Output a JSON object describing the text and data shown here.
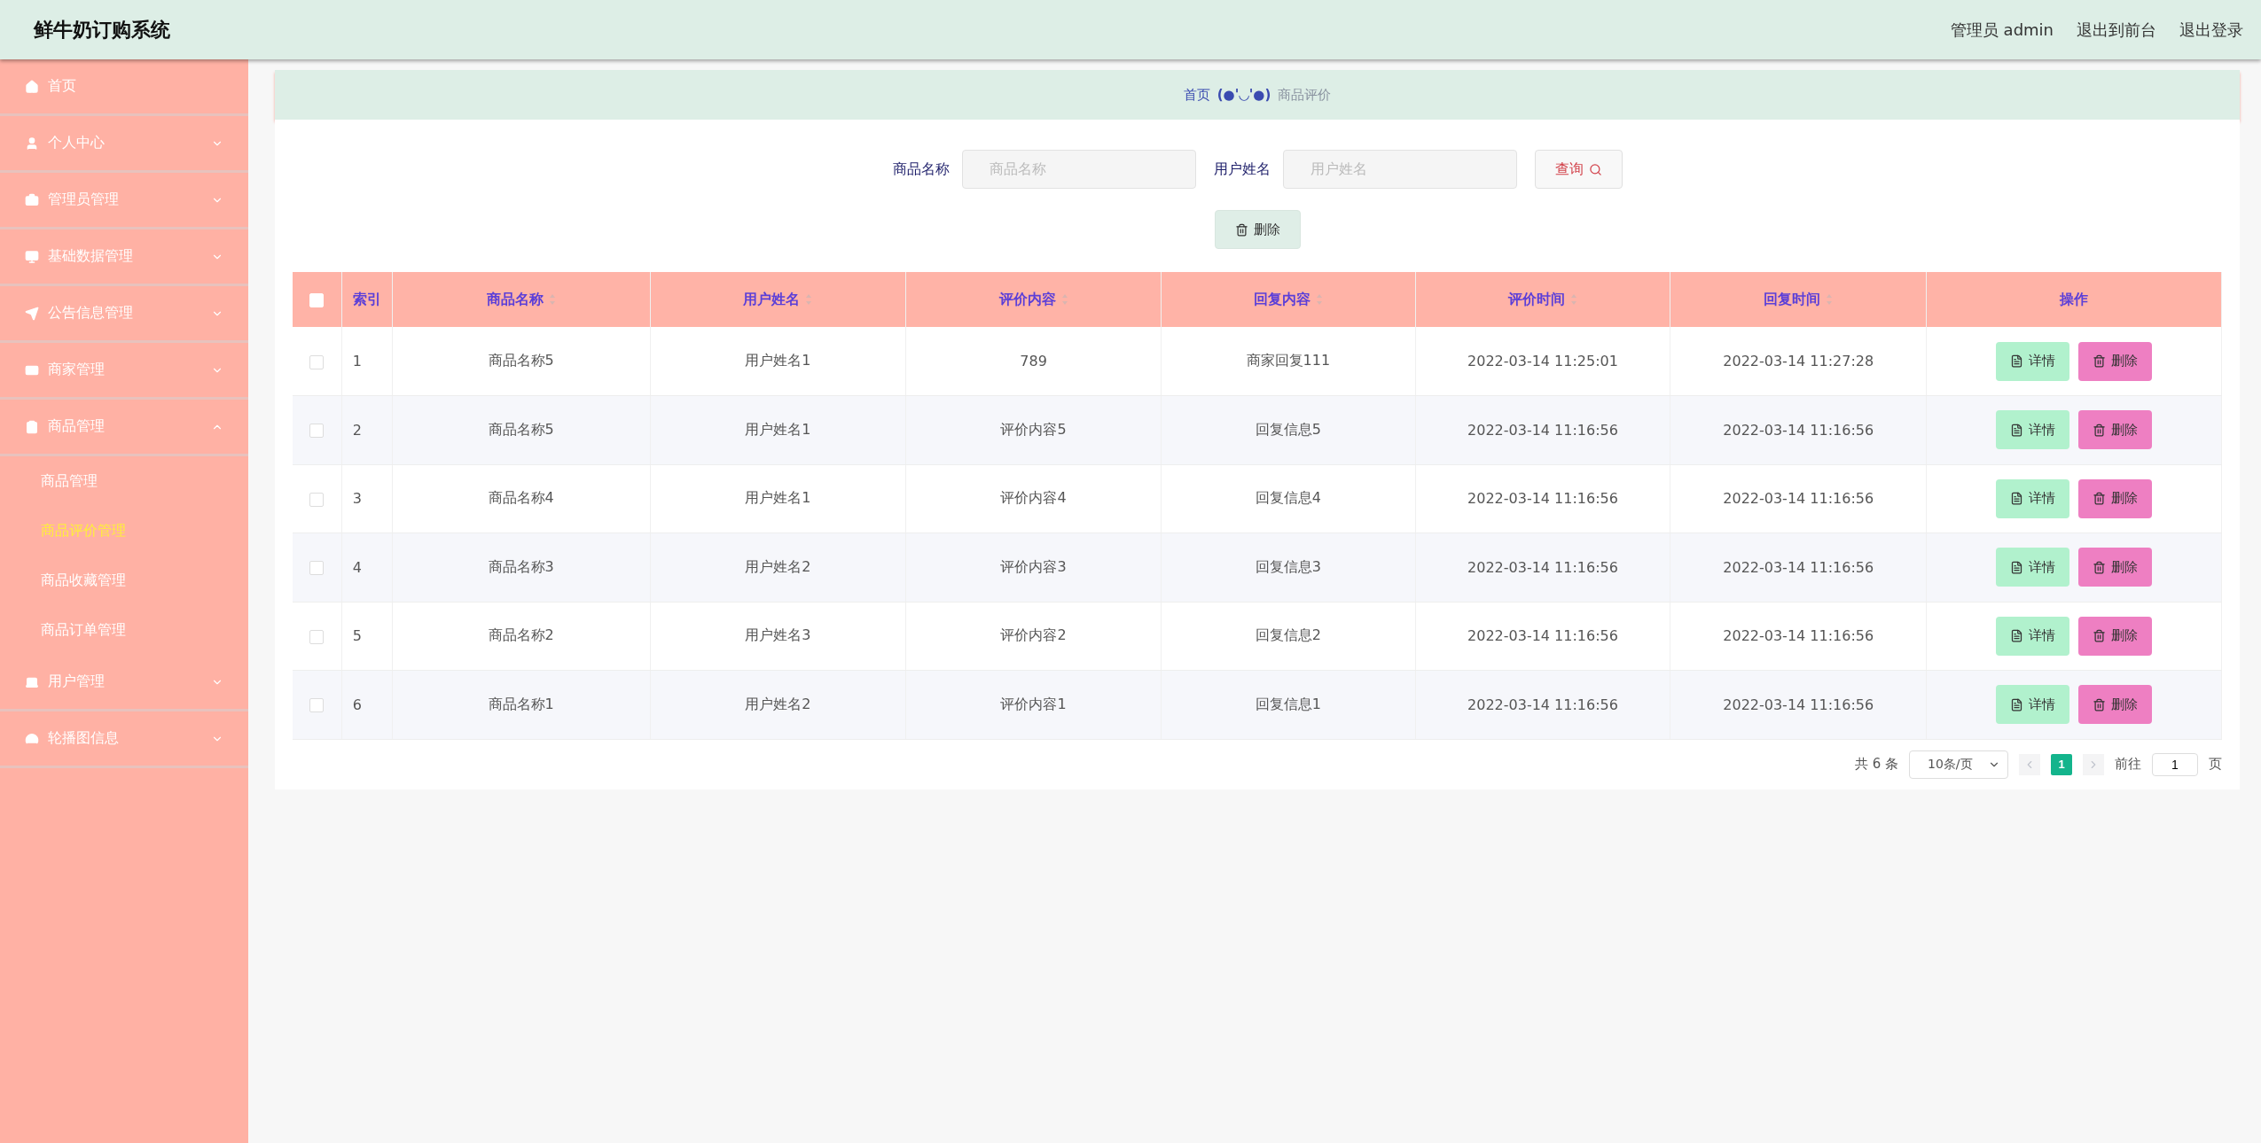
{
  "header": {
    "title": "鲜牛奶订购系统",
    "user": "管理员 admin",
    "links": [
      "退出到前台",
      "退出登录"
    ]
  },
  "sidebar": {
    "items": [
      {
        "label": "首页"
      },
      {
        "label": "个人中心",
        "expanded": false
      },
      {
        "label": "管理员管理",
        "expanded": false
      },
      {
        "label": "基础数据管理",
        "expanded": false
      },
      {
        "label": "公告信息管理",
        "expanded": false
      },
      {
        "label": "商家管理",
        "expanded": false
      },
      {
        "label": "商品管理",
        "expanded": true,
        "children": [
          {
            "label": "商品管理",
            "selected": false
          },
          {
            "label": "商品评价管理",
            "selected": true
          },
          {
            "label": "商品收藏管理",
            "selected": false
          },
          {
            "label": "商品订单管理",
            "selected": false
          }
        ]
      },
      {
        "label": "用户管理",
        "expanded": false
      },
      {
        "label": "轮播图信息",
        "expanded": false
      }
    ]
  },
  "breadcrumb": {
    "home": "首页",
    "separator": "(●'◡'●)",
    "current": "商品评价"
  },
  "search": {
    "fields": [
      {
        "label": "商品名称",
        "placeholder": "商品名称"
      },
      {
        "label": "用户姓名",
        "placeholder": "用户姓名"
      }
    ],
    "button": "查询"
  },
  "bulk_delete": "删除",
  "table": {
    "select_all": {
      "checked": false
    },
    "columns": [
      {
        "label": "索引",
        "sortable": false
      },
      {
        "label": "商品名称",
        "sortable": true
      },
      {
        "label": "用户姓名",
        "sortable": true
      },
      {
        "label": "评价内容",
        "sortable": true
      },
      {
        "label": "回复内容",
        "sortable": true
      },
      {
        "label": "评价时间",
        "sortable": true
      },
      {
        "label": "回复时间",
        "sortable": true
      },
      {
        "label": "操作",
        "sortable": false
      }
    ],
    "rows": [
      {
        "selected": false,
        "cells": [
          "1",
          "商品名称5",
          "用户姓名1",
          "789",
          "商家回复111",
          "2022-03-14 11:25:01",
          "2022-03-14 11:27:28"
        ],
        "actions": [
          "详情",
          "删除"
        ]
      },
      {
        "selected": false,
        "cells": [
          "2",
          "商品名称5",
          "用户姓名1",
          "评价内容5",
          "回复信息5",
          "2022-03-14 11:16:56",
          "2022-03-14 11:16:56"
        ],
        "actions": [
          "详情",
          "删除"
        ]
      },
      {
        "selected": false,
        "cells": [
          "3",
          "商品名称4",
          "用户姓名1",
          "评价内容4",
          "回复信息4",
          "2022-03-14 11:16:56",
          "2022-03-14 11:16:56"
        ],
        "actions": [
          "详情",
          "删除"
        ]
      },
      {
        "selected": false,
        "cells": [
          "4",
          "商品名称3",
          "用户姓名2",
          "评价内容3",
          "回复信息3",
          "2022-03-14 11:16:56",
          "2022-03-14 11:16:56"
        ],
        "actions": [
          "详情",
          "删除"
        ]
      },
      {
        "selected": false,
        "cells": [
          "5",
          "商品名称2",
          "用户姓名3",
          "评价内容2",
          "回复信息2",
          "2022-03-14 11:16:56",
          "2022-03-14 11:16:56"
        ],
        "actions": [
          "详情",
          "删除"
        ]
      },
      {
        "selected": false,
        "cells": [
          "6",
          "商品名称1",
          "用户姓名2",
          "评价内容1",
          "回复信息1",
          "2022-03-14 11:16:56",
          "2022-03-14 11:16:56"
        ],
        "actions": [
          "详情",
          "删除"
        ]
      }
    ]
  },
  "pagination": {
    "total": "共 6 条",
    "page_size": "10条/页",
    "pages": [
      {
        "label": "1",
        "selected": true
      }
    ],
    "goto": "前往",
    "goto_value": "1",
    "page_unit": "页"
  }
}
